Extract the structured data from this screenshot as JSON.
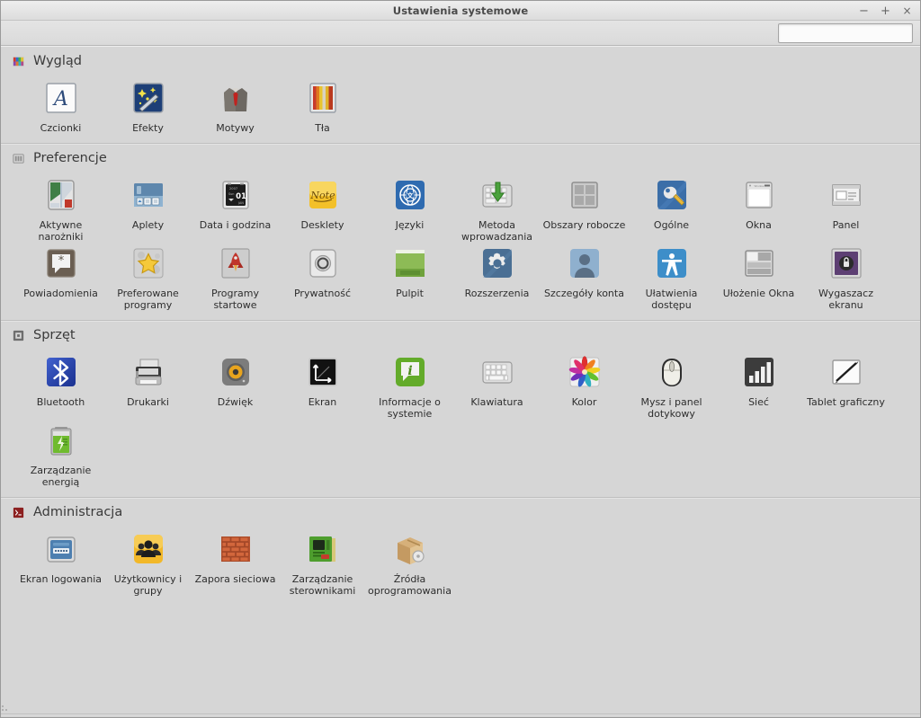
{
  "window": {
    "title": "Ustawienia systemowe",
    "buttons": [
      {
        "name": "minimize-button",
        "glyph": "−"
      },
      {
        "name": "maximize-button",
        "glyph": "+"
      },
      {
        "name": "close-button",
        "glyph": "×"
      }
    ]
  },
  "search": {
    "value": "",
    "placeholder": "",
    "icon": "search-icon",
    "clear_icon": "clear-backspace-icon"
  },
  "colors": {
    "window_bg": "#d6d6d6",
    "titlebar": "#e8e8e8",
    "text": "#2e2e2e",
    "section_title": "#3a3a3a",
    "divider": "#bfbfbf",
    "accent_blue": "#3c6ea5",
    "admin_red": "#992222"
  },
  "sections": [
    {
      "id": "appearance",
      "title": "Wygląd",
      "icon": "palette-icon",
      "items": [
        {
          "id": "fonts",
          "label": "Czcionki",
          "icon": "fonts-icon"
        },
        {
          "id": "effects",
          "label": "Efekty",
          "icon": "effects-icon"
        },
        {
          "id": "themes",
          "label": "Motywy",
          "icon": "themes-icon"
        },
        {
          "id": "backgrounds",
          "label": "Tła",
          "icon": "backgrounds-icon"
        }
      ]
    },
    {
      "id": "preferences",
      "title": "Preferencje",
      "icon": "preferences-icon",
      "items": [
        {
          "id": "hot-corners",
          "label": "Aktywne narożniki",
          "icon": "hot-corners-icon"
        },
        {
          "id": "applets",
          "label": "Aplety",
          "icon": "applets-icon"
        },
        {
          "id": "date-time",
          "label": "Data i godzina",
          "icon": "date-time-icon"
        },
        {
          "id": "desklets",
          "label": "Desklety",
          "icon": "desklets-icon"
        },
        {
          "id": "languages",
          "label": "Języki",
          "icon": "languages-icon"
        },
        {
          "id": "input-method",
          "label": "Metoda wprowadzania",
          "icon": "input-method-icon"
        },
        {
          "id": "workspaces",
          "label": "Obszary robocze",
          "icon": "workspaces-icon"
        },
        {
          "id": "general",
          "label": "Ogólne",
          "icon": "general-icon"
        },
        {
          "id": "windows",
          "label": "Okna",
          "icon": "windows-icon"
        },
        {
          "id": "panel",
          "label": "Panel",
          "icon": "panel-icon"
        },
        {
          "id": "notifications",
          "label": "Powiadomienia",
          "icon": "notifications-icon"
        },
        {
          "id": "preferred-apps",
          "label": "Preferowane programy",
          "icon": "preferred-apps-icon"
        },
        {
          "id": "startup-apps",
          "label": "Programy startowe",
          "icon": "startup-apps-icon"
        },
        {
          "id": "privacy",
          "label": "Prywatność",
          "icon": "privacy-icon"
        },
        {
          "id": "desktop",
          "label": "Pulpit",
          "icon": "desktop-icon"
        },
        {
          "id": "extensions",
          "label": "Rozszerzenia",
          "icon": "extensions-icon"
        },
        {
          "id": "account-details",
          "label": "Szczegóły konta",
          "icon": "account-details-icon"
        },
        {
          "id": "accessibility",
          "label": "Ułatwienia dostępu",
          "icon": "accessibility-icon"
        },
        {
          "id": "window-tiling",
          "label": "Ułożenie Okna",
          "icon": "window-tiling-icon"
        },
        {
          "id": "screensaver",
          "label": "Wygaszacz ekranu",
          "icon": "screensaver-icon"
        }
      ]
    },
    {
      "id": "hardware",
      "title": "Sprzęt",
      "icon": "hardware-icon",
      "items": [
        {
          "id": "bluetooth",
          "label": "Bluetooth",
          "icon": "bluetooth-icon"
        },
        {
          "id": "printers",
          "label": "Drukarki",
          "icon": "printers-icon"
        },
        {
          "id": "sound",
          "label": "Dźwięk",
          "icon": "sound-icon"
        },
        {
          "id": "display",
          "label": "Ekran",
          "icon": "display-icon"
        },
        {
          "id": "system-info",
          "label": "Informacje o systemie",
          "icon": "system-info-icon"
        },
        {
          "id": "keyboard",
          "label": "Klawiatura",
          "icon": "keyboard-icon"
        },
        {
          "id": "color",
          "label": "Kolor",
          "icon": "color-icon"
        },
        {
          "id": "mouse",
          "label": "Mysz i panel dotykowy",
          "icon": "mouse-icon"
        },
        {
          "id": "network",
          "label": "Sieć",
          "icon": "network-icon"
        },
        {
          "id": "tablet",
          "label": "Tablet graficzny",
          "icon": "tablet-icon"
        },
        {
          "id": "power",
          "label": "Zarządzanie energią",
          "icon": "power-icon"
        }
      ]
    },
    {
      "id": "administration",
      "title": "Administracja",
      "icon": "administration-icon",
      "items": [
        {
          "id": "login-window",
          "label": "Ekran logowania",
          "icon": "login-window-icon"
        },
        {
          "id": "users-groups",
          "label": "Użytkownicy i grupy",
          "icon": "users-groups-icon"
        },
        {
          "id": "firewall",
          "label": "Zapora sieciowa",
          "icon": "firewall-icon"
        },
        {
          "id": "driver-manager",
          "label": "Zarządzanie sterownikami",
          "icon": "driver-manager-icon"
        },
        {
          "id": "software-sources",
          "label": "Źródła oprogramowania",
          "icon": "software-sources-icon"
        }
      ]
    }
  ]
}
